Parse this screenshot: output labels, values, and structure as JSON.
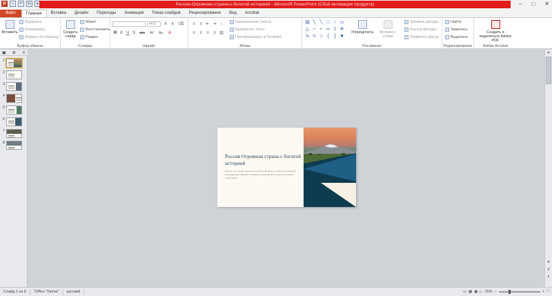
{
  "window": {
    "title": "Россия-Огромная-страна-с-богатой-историей - Microsoft PowerPoint (Сбой активации продукта)",
    "controls": [
      "–",
      "□",
      "✕"
    ]
  },
  "tabs": [
    {
      "label": "Файл"
    },
    {
      "label": "Главная"
    },
    {
      "label": "Вставка"
    },
    {
      "label": "Дизайн"
    },
    {
      "label": "Переходы"
    },
    {
      "label": "Анимация"
    },
    {
      "label": "Показ слайдов"
    },
    {
      "label": "Рецензирование"
    },
    {
      "label": "Вид"
    },
    {
      "label": "Acrobat"
    }
  ],
  "ribbon": {
    "clipboard": {
      "label": "Буфер обмена",
      "paste": "Вставить",
      "cut": "Вырезать",
      "copy": "Копировать",
      "format_painter": "Формат по образцу"
    },
    "slides": {
      "label": "Слайды",
      "new_slide": "Создать слайд",
      "layout": "Макет",
      "reset": "Восстановить",
      "section": "Раздел"
    },
    "font": {
      "label": "Шрифт",
      "size": "44,5",
      "bold": "Ж",
      "italic": "К",
      "underline": "Ч",
      "strike": "S",
      "shadow": "abc",
      "spacing": "AV",
      "case": "Aa",
      "grow": "A",
      "shrink": "A"
    },
    "paragraph": {
      "label": "Абзац",
      "text_direction": "Направление текста",
      "align_text": "Выровнять текст",
      "smartart": "Преобразовать в SmartArt"
    },
    "drawing": {
      "label": "Рисование",
      "arrange": "Упорядочить",
      "quick_styles": "Экспресс-стили",
      "shape_fill": "Заливка фигуры",
      "shape_outline": "Контур фигуры",
      "shape_effects": "Эффекты фигур"
    },
    "editing": {
      "label": "Редактирование",
      "find": "Найти",
      "replace": "Заменить",
      "select": "Выделить"
    },
    "acrobat": {
      "label": "Adobe Acrobat",
      "create_share": "Создать и поделиться Adobe PDF"
    }
  },
  "slides_panel": {
    "numbers": [
      "1",
      "2",
      "3",
      "4",
      "5",
      "6",
      "7",
      "8"
    ]
  },
  "slide": {
    "title": "Россия Огромная страна с богатой историей",
    "body": "Россия - это страна, история которой полна богатых событий, личностей, культурных достижений и сложных отношений. Её история охватывает тысячелетие."
  },
  "status": {
    "slide_counter": "Слайд 1 из 8",
    "theme": "\"Office Theme\"",
    "language": "русский",
    "zoom": "25%"
  },
  "colors": {
    "file_tab": "#d24726",
    "title_bar_red": "#e21b1b",
    "slide_dark_teal": "#0e3c4e",
    "slide_blue": "#1f5f86",
    "slide_title": "#1f3d5c"
  }
}
